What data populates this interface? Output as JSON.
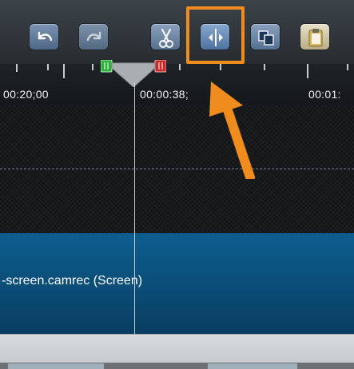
{
  "toolbar": {
    "buttons": [
      {
        "id": "undo",
        "icon": "undo-icon"
      },
      {
        "id": "redo",
        "icon": "redo-icon"
      },
      {
        "id": "cut",
        "icon": "scissors-icon"
      },
      {
        "id": "split",
        "icon": "split-icon"
      },
      {
        "id": "copy",
        "icon": "copy-icon"
      },
      {
        "id": "paste",
        "icon": "paste-icon"
      }
    ]
  },
  "ruler": {
    "labels": [
      "00:20;00",
      "00:00:38;",
      "00:01:"
    ]
  },
  "clip": {
    "label": "-screen.camrec (Screen)"
  },
  "annotation": {
    "color": "#f08b1e",
    "target": "split-button"
  }
}
